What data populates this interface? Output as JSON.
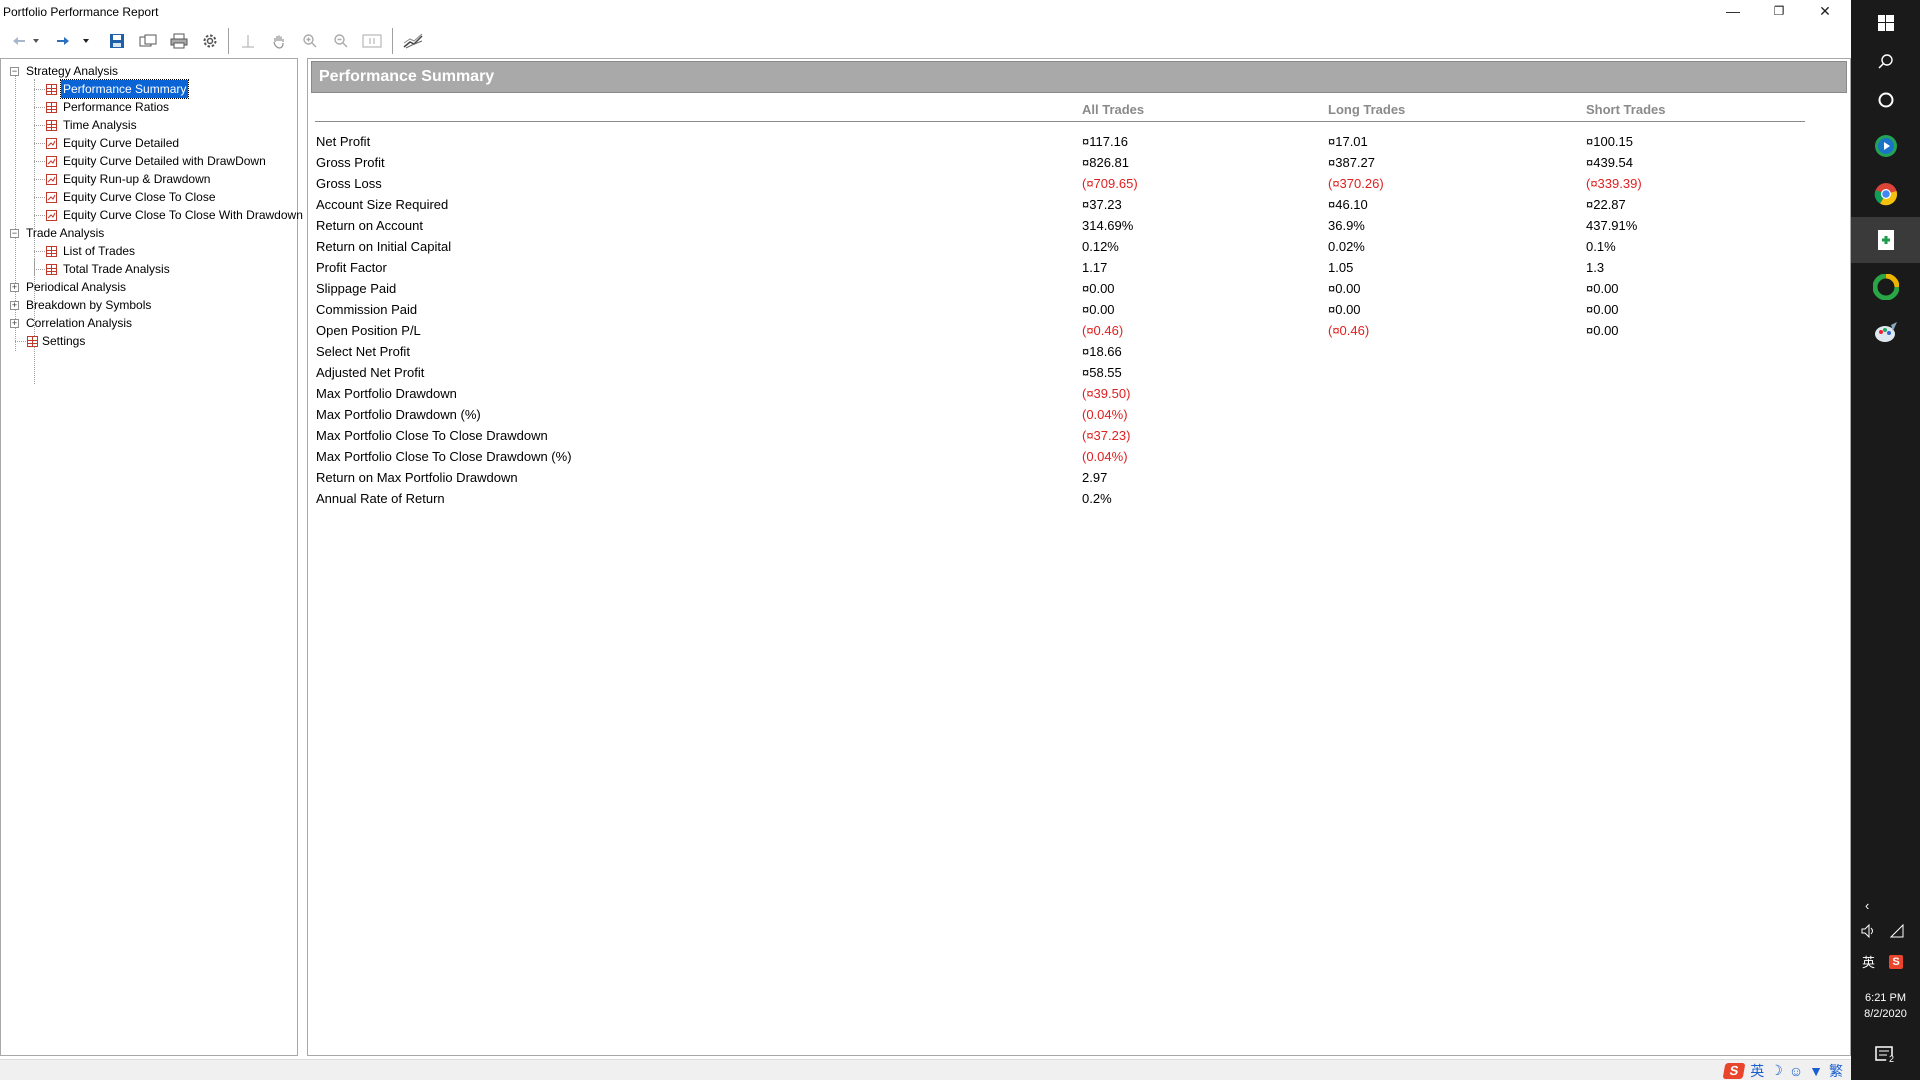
{
  "window": {
    "title": "Portfolio Performance Report",
    "minimize_glyph": "—",
    "restore_glyph": "❐",
    "close_glyph": "✕"
  },
  "toolbar": {
    "icons": [
      "back-icon",
      "dropdown-icon",
      "forward-icon",
      "dropdown-icon",
      "save-icon",
      "export-icon",
      "print-icon",
      "gear-icon",
      "crosshair-icon",
      "hand-icon",
      "zoom-in-icon",
      "zoom-out-icon",
      "fit-icon",
      "chart-style-icon"
    ]
  },
  "tree": {
    "strategy_analysis": "Strategy Analysis",
    "strategy_children": [
      "Performance Summary",
      "Performance Ratios",
      "Time Analysis",
      "Equity Curve Detailed",
      "Equity Curve Detailed with DrawDown",
      "Equity Run-up & Drawdown",
      "Equity Curve Close To Close",
      "Equity Curve Close To Close With Drawdown"
    ],
    "trade_analysis": "Trade Analysis",
    "trade_children": [
      "List of Trades",
      "Total Trade Analysis"
    ],
    "periodical_analysis": "Periodical Analysis",
    "breakdown_by_symbols": "Breakdown by Symbols",
    "correlation_analysis": "Correlation Analysis",
    "settings": "Settings",
    "selected": "Performance Summary"
  },
  "report": {
    "title": "Performance Summary",
    "columns": [
      "All Trades",
      "Long Trades",
      "Short Trades"
    ],
    "rows": [
      {
        "label": "Net Profit",
        "all": "¤117.16",
        "long": "¤17.01",
        "short": "¤100.15"
      },
      {
        "label": "Gross Profit",
        "all": "¤826.81",
        "long": "¤387.27",
        "short": "¤439.54"
      },
      {
        "label": "Gross Loss",
        "all": "(¤709.65)",
        "long": "(¤370.26)",
        "short": "(¤339.39)"
      },
      {
        "label": "Account Size Required",
        "all": "¤37.23",
        "long": "¤46.10",
        "short": "¤22.87"
      },
      {
        "label": "Return on Account",
        "all": "314.69%",
        "long": "36.9%",
        "short": "437.91%"
      },
      {
        "label": "Return on Initial Capital",
        "all": "0.12%",
        "long": "0.02%",
        "short": "0.1%"
      },
      {
        "label": "Profit Factor",
        "all": "1.17",
        "long": "1.05",
        "short": "1.3"
      },
      {
        "label": "Slippage Paid",
        "all": "¤0.00",
        "long": "¤0.00",
        "short": "¤0.00"
      },
      {
        "label": "Commission Paid",
        "all": "¤0.00",
        "long": "¤0.00",
        "short": "¤0.00"
      },
      {
        "label": "Open Position P/L",
        "all": "(¤0.46)",
        "long": "(¤0.46)",
        "short": "¤0.00"
      },
      {
        "label": "Select Net Profit",
        "all": "¤18.66",
        "long": "",
        "short": ""
      },
      {
        "label": "Adjusted Net Profit",
        "all": "¤58.55",
        "long": "",
        "short": ""
      },
      {
        "label": "Max Portfolio Drawdown",
        "all": "(¤39.50)",
        "long": "",
        "short": ""
      },
      {
        "label": "Max Portfolio Drawdown (%)",
        "all": "(0.04%)",
        "long": "",
        "short": ""
      },
      {
        "label": "Max Portfolio Close To Close Drawdown",
        "all": "(¤37.23)",
        "long": "",
        "short": ""
      },
      {
        "label": "Max Portfolio Close To Close Drawdown (%)",
        "all": "(0.04%)",
        "long": "",
        "short": ""
      },
      {
        "label": "Return on Max Portfolio Drawdown",
        "all": "2.97",
        "long": "",
        "short": ""
      },
      {
        "label": "Annual Rate of Return",
        "all": "0.2%",
        "long": "",
        "short": ""
      }
    ],
    "negative_color": "#e02020"
  },
  "statusbar": {
    "ime_items": [
      "英",
      "☽",
      "☺",
      "繁"
    ]
  },
  "taskbar": {
    "apps": [
      "windows-start-icon",
      "search-icon",
      "task-view-icon",
      "media-player-icon",
      "chrome-icon",
      "portfolio-app-icon",
      "app-icon",
      "paint-icon"
    ],
    "time": "6:21 PM",
    "date": "8/2/2020",
    "ime": "英",
    "notification_count": "2"
  }
}
